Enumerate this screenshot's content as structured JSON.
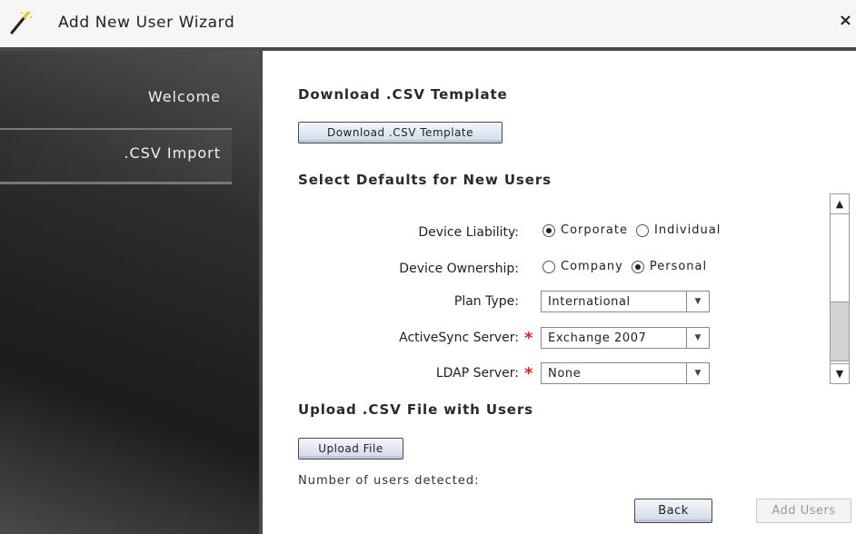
{
  "window": {
    "title": "Add New User Wizard",
    "close_glyph": "×",
    "icon": "magic-wand-icon"
  },
  "sidebar": {
    "steps": [
      {
        "label": "Welcome",
        "active": false
      },
      {
        "label": ".CSV Import",
        "active": true
      }
    ]
  },
  "download_section": {
    "heading": "Download .CSV Template",
    "button_label": "Download .CSV Template"
  },
  "defaults_section": {
    "heading": "Select Defaults for New Users",
    "device_liability": {
      "label": "Device Liability:",
      "options": [
        "Corporate",
        "Individual"
      ],
      "selected": "Corporate"
    },
    "device_ownership": {
      "label": "Device Ownership:",
      "options": [
        "Company",
        "Personal"
      ],
      "selected": "Personal"
    },
    "plan_type": {
      "label": "Plan Type:",
      "value": "International"
    },
    "activesync_server": {
      "label": "ActiveSync Server:",
      "value": "Exchange 2007",
      "required": true
    },
    "ldap_server": {
      "label": "LDAP Server:",
      "value": "None",
      "required": true
    },
    "required_marker": "*"
  },
  "upload_section": {
    "heading": "Upload .CSV File with Users",
    "button_label": "Upload File",
    "users_detected_label": "Number of users detected:"
  },
  "footer": {
    "back_label": "Back",
    "add_users_label": "Add Users",
    "add_users_enabled": false
  },
  "colors": {
    "required": "#dd2222",
    "sidebar_dark": "#1c1c1c",
    "button_fill": "#cfd9e6"
  }
}
